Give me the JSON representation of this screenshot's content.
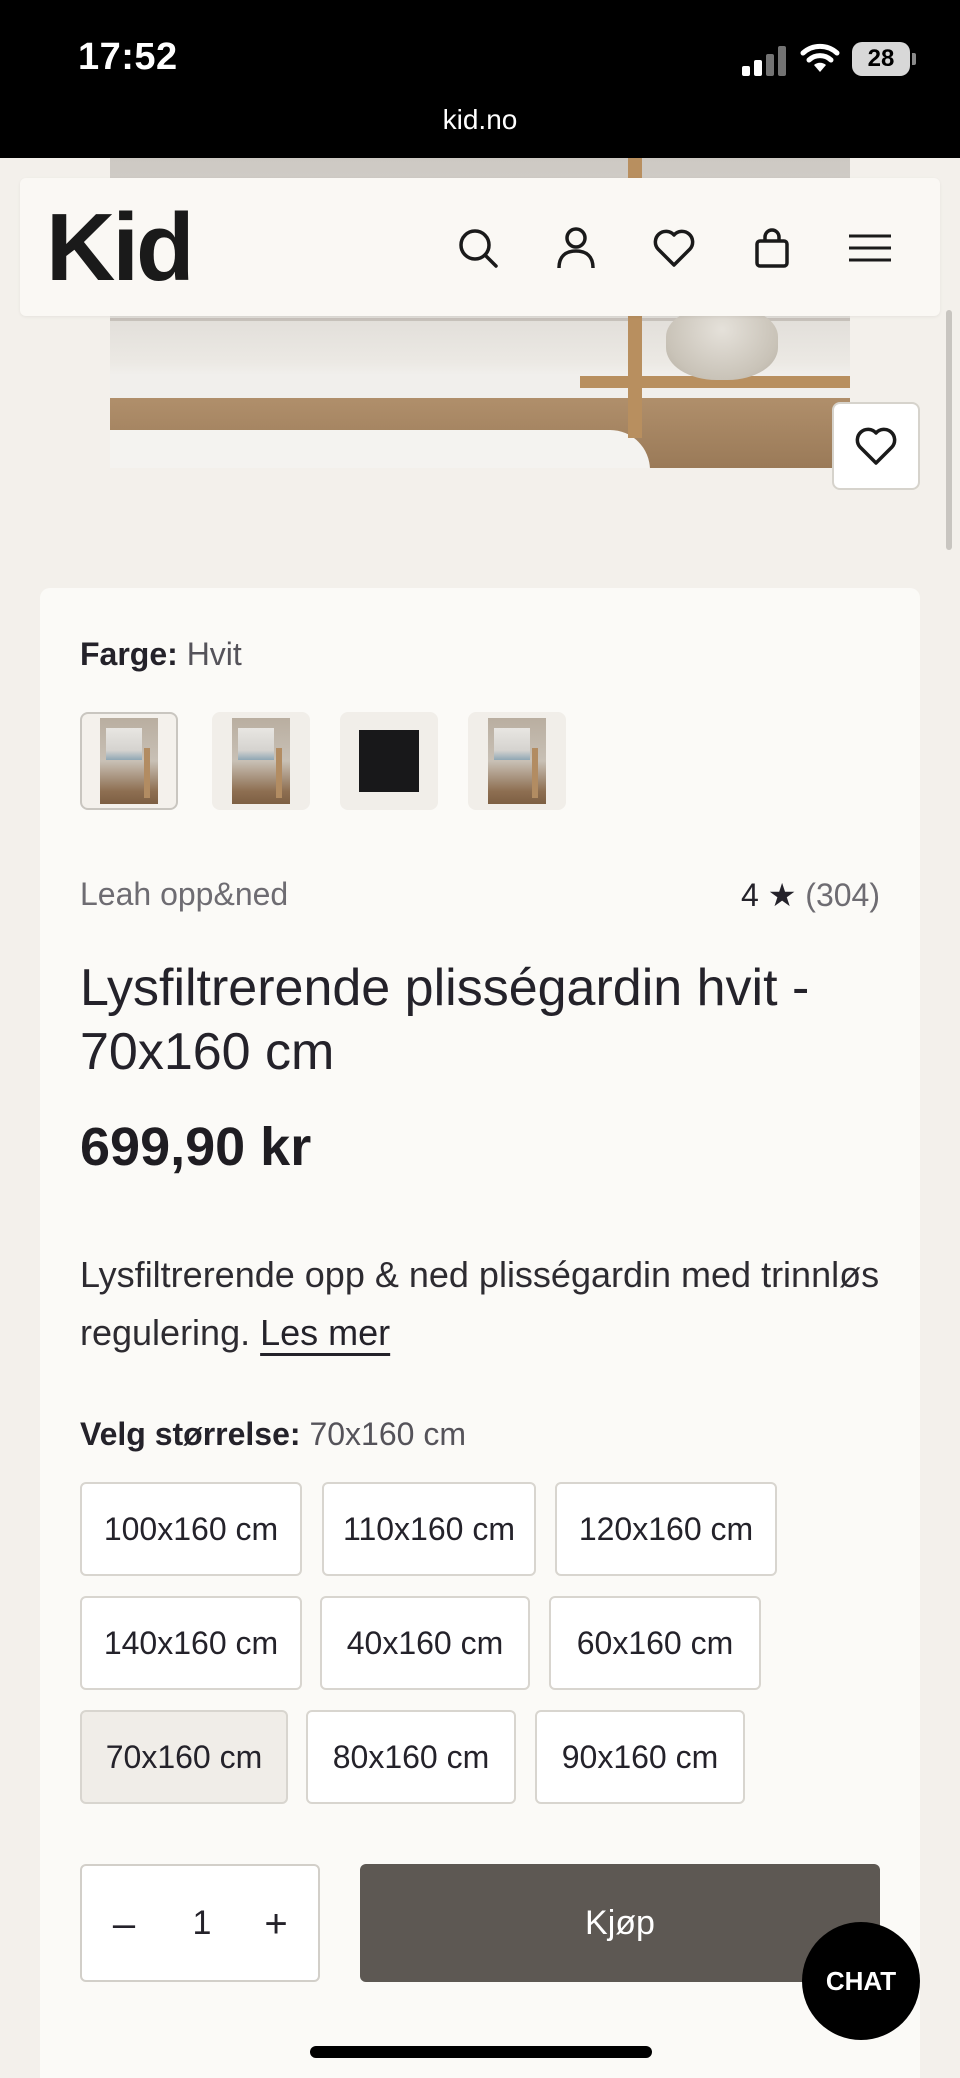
{
  "status_bar": {
    "time": "17:52",
    "battery": "28",
    "url": "kid.no"
  },
  "header": {
    "logo": "Kid",
    "icons": [
      "search-icon",
      "account-icon",
      "favorites-icon",
      "cart-icon",
      "menu-icon"
    ]
  },
  "product": {
    "color_label": "Farge:",
    "color_value": "Hvit",
    "brand": "Leah opp&ned",
    "rating": "4 ★",
    "rating_count": "(304)",
    "title": "Lysfiltrerende plisségardin hvit - 70x160 cm",
    "price": "699,90 kr",
    "description": "Lysfiltrerende opp & ned plisségardin med trinnløs regulering.",
    "read_more": "Les mer",
    "size_label": "Velg størrelse:",
    "size_value": "70x160 cm",
    "sizes": [
      "100x160 cm",
      "110x160 cm",
      "120x160 cm",
      "140x160 cm",
      "40x160 cm",
      "60x160 cm",
      "70x160 cm",
      "80x160 cm",
      "90x160 cm"
    ],
    "selected_size": "70x160 cm",
    "quantity": "1",
    "buy_label": "Kjøp"
  },
  "chat_label": "CHAT",
  "colors": {
    "page_bg": "#f3f0eb",
    "card_bg": "#fbfaf7",
    "buy_button": "#5d5853",
    "text": "#24222a"
  }
}
